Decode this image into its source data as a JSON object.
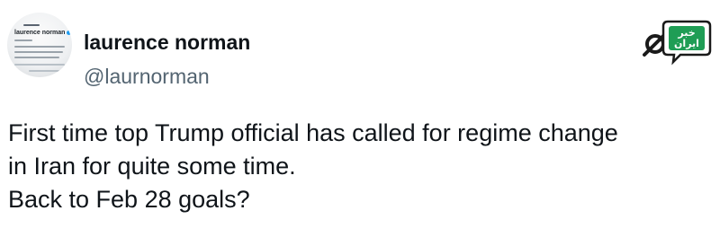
{
  "author": {
    "name": "laurence norman",
    "handle": "@laurnorman"
  },
  "tweet": {
    "lines": [
      "First time top Trump official has called for regime change",
      "in Iran for quite some time.",
      "Back to Feb 28 goals?"
    ]
  },
  "logo": {
    "text_top": "خبر",
    "text_bottom": "ایران",
    "icon": "chat-bubble-logo-icon",
    "color": "#1f9d55"
  }
}
